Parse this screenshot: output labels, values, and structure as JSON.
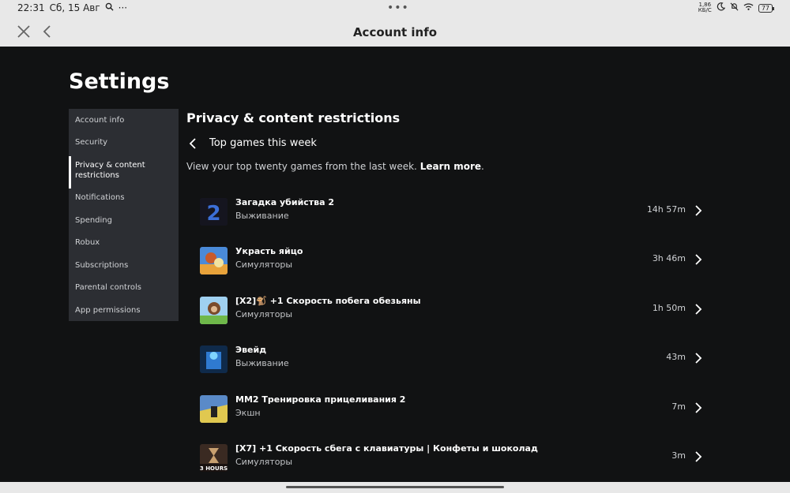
{
  "status_bar": {
    "time": "22:31",
    "date": "Сб, 15 Авг",
    "net_speed_top": "1,86",
    "net_speed_bottom": "КБ/С",
    "battery": "77"
  },
  "header": {
    "title": "Account info"
  },
  "settings": {
    "title": "Settings"
  },
  "sidebar": {
    "items": [
      {
        "label": "Account info"
      },
      {
        "label": "Security"
      },
      {
        "label": "Privacy & content restrictions"
      },
      {
        "label": "Notifications"
      },
      {
        "label": "Spending"
      },
      {
        "label": "Robux"
      },
      {
        "label": "Subscriptions"
      },
      {
        "label": "Parental controls"
      },
      {
        "label": "App permissions"
      }
    ]
  },
  "content": {
    "section_title": "Privacy & content restrictions",
    "subsection_title": "Top games this week",
    "description": "View your top twenty games from the last week.",
    "learn_more": "Learn more",
    "period": "."
  },
  "games": [
    {
      "name": "Загадка убийства 2",
      "genre": "Выживание",
      "time": "14h 57m",
      "thumb_color": "#1b1b2e",
      "thumb_text": "2"
    },
    {
      "name": "Украсть яйцо",
      "genre": "Симуляторы",
      "time": "3h 46m",
      "thumb_color": "#e8a23a",
      "thumb_text": ""
    },
    {
      "name": "[X2]🐒 +1 Скорость побега обезьяны",
      "genre": "Симуляторы",
      "time": "1h 50m",
      "thumb_color": "#7fbf5a",
      "thumb_text": ""
    },
    {
      "name": "Эвейд",
      "genre": "Выживание",
      "time": "43m",
      "thumb_color": "#1f4b7a",
      "thumb_text": ""
    },
    {
      "name": "MM2 Тренировка прицеливания 2",
      "genre": "Экшн",
      "time": "7m",
      "thumb_color": "#d9c24a",
      "thumb_text": ""
    },
    {
      "name": "[X7] +1 Скорость сбега с клавиатуры | Конфеты и шоколад",
      "genre": "Симуляторы",
      "time": "3m",
      "thumb_color": "#3a2a22",
      "thumb_text": "3 HOURS"
    }
  ]
}
